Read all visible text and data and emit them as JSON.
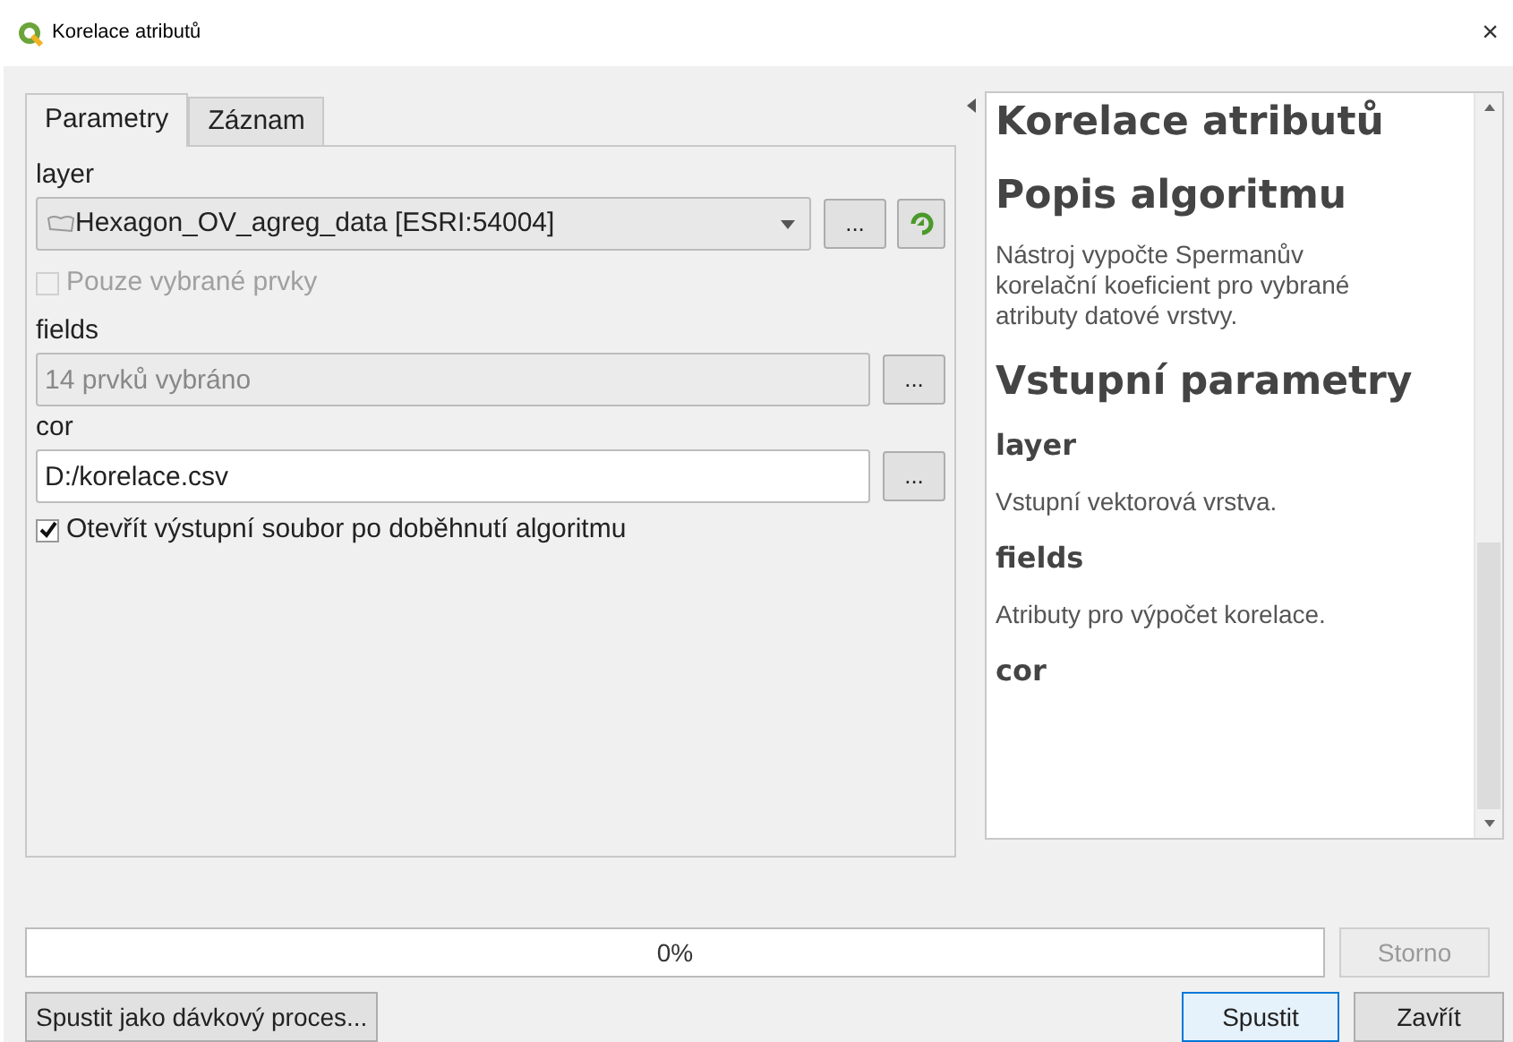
{
  "window": {
    "title": "Korelace atributů",
    "close": "×"
  },
  "tabs": [
    {
      "label": "Parametry",
      "selected": true
    },
    {
      "label": "Záznam",
      "selected": false
    }
  ],
  "params": [
    {
      "kind": "label",
      "text": "layer"
    },
    {
      "kind": "combo",
      "value": "Hexagon_OV_agreg_data [ESRI:54004]",
      "button": "..."
    },
    {
      "kind": "checkbox",
      "text": "Pouze vybrané prvky",
      "checked": false,
      "disabled": true
    },
    {
      "kind": "label",
      "text": "fields"
    },
    {
      "kind": "field",
      "value": "14 prvků vybráno",
      "disabled": true,
      "button": "..."
    },
    {
      "kind": "label",
      "text": "cor"
    },
    {
      "kind": "field",
      "value": "D:/korelace.csv",
      "disabled": false,
      "button": "..."
    },
    {
      "kind": "checkbox",
      "text": "Otevřít výstupní soubor po doběhnutí algoritmu",
      "checked": true,
      "disabled": false
    }
  ],
  "help": [
    {
      "kind": "h1",
      "text": "Korelace atributů"
    },
    {
      "kind": "h1",
      "text": "Popis algoritmu"
    },
    {
      "kind": "p",
      "text": "Nástroj vypočte Spermanův korelační koeficient pro vybrané atributy datové vrstvy."
    },
    {
      "kind": "h1",
      "text": "Vstupní parametry"
    },
    {
      "kind": "h2",
      "text": "layer"
    },
    {
      "kind": "p",
      "text": "Vstupní vektorová vrstva."
    },
    {
      "kind": "h2",
      "text": "fields"
    },
    {
      "kind": "p",
      "text": "Atributy pro výpočet korelace."
    },
    {
      "kind": "h2",
      "text": "cor"
    }
  ],
  "progress": {
    "level": 0,
    "text": "0%"
  },
  "cancel_button": {
    "label": "Storno",
    "disabled": true
  },
  "batch_button": "Spustit jako dávkový proces...",
  "run_button": "Spustit",
  "close_button": "Zavřít"
}
